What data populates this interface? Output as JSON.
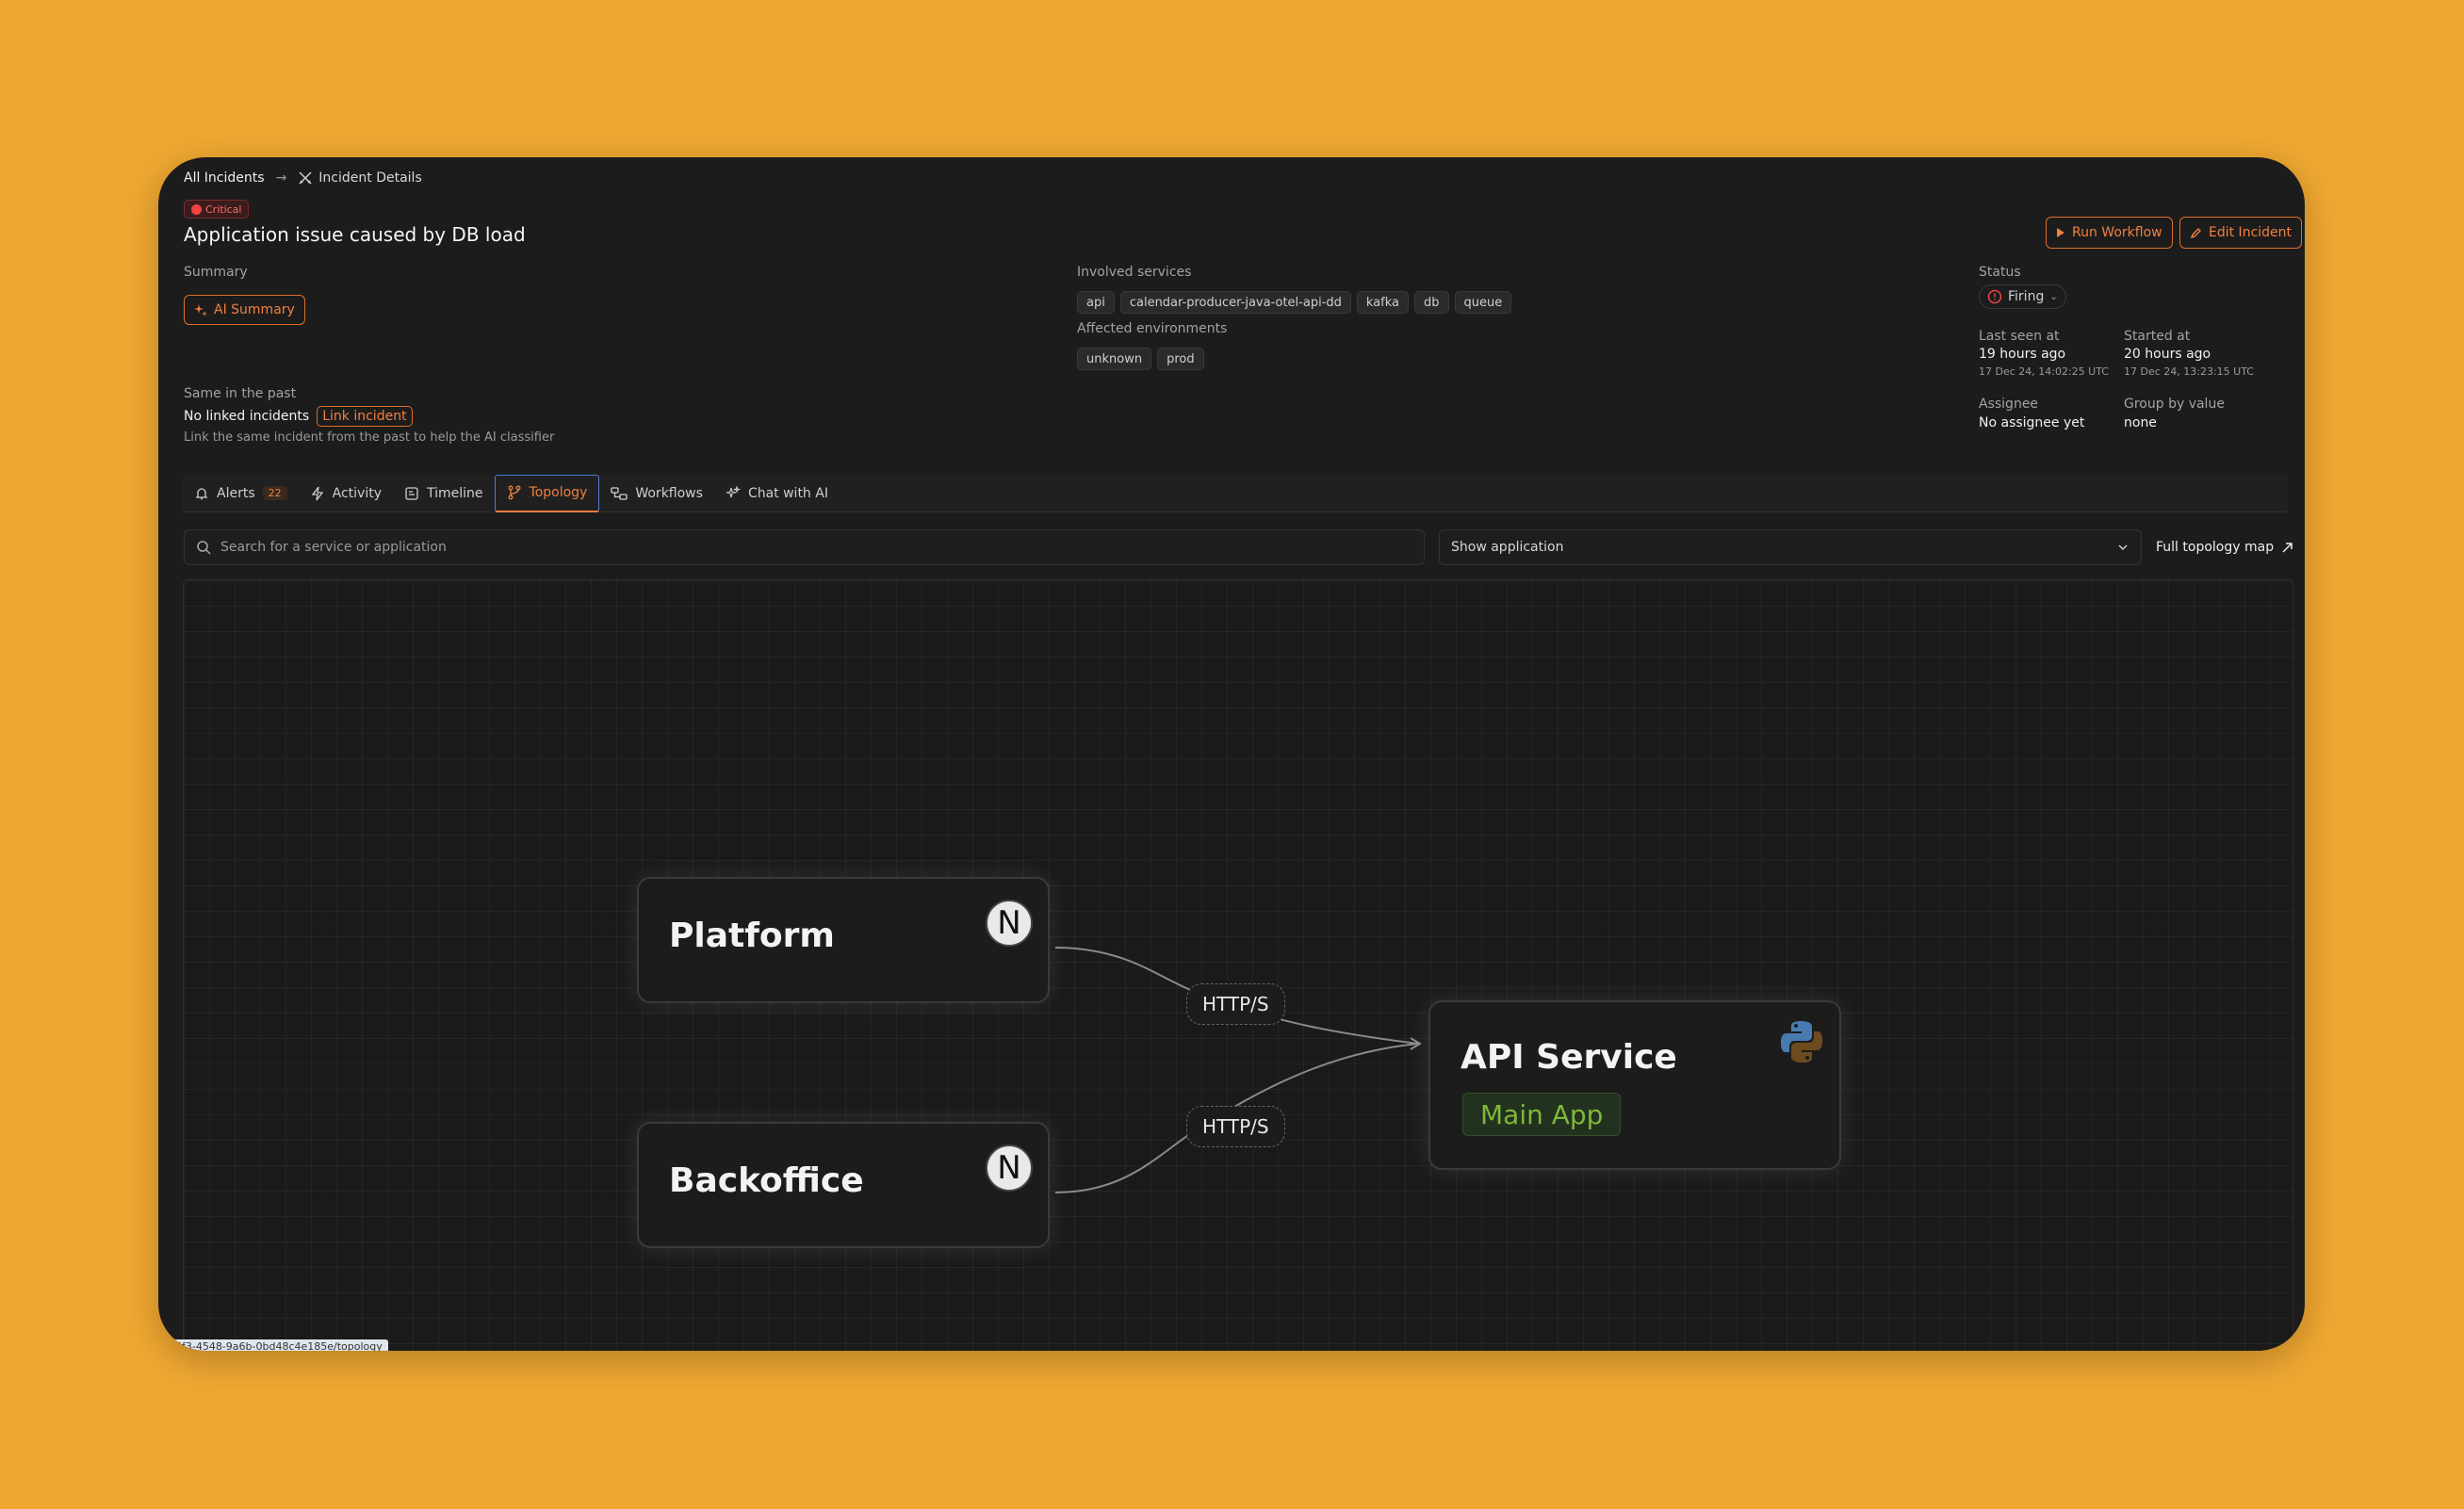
{
  "breadcrumb": {
    "root": "All Incidents",
    "current": "Incident Details"
  },
  "incident": {
    "severity": "Critical",
    "title": "Application issue caused by DB load"
  },
  "actions": {
    "run_workflow": "Run Workflow",
    "edit_incident": "Edit Incident"
  },
  "summary": {
    "label": "Summary",
    "ai_button": "AI Summary"
  },
  "past": {
    "label": "Same in the past",
    "no_linked": "No linked incidents",
    "link_button": "Link incident",
    "hint": "Link the same incident from the past to help the AI classifier"
  },
  "services": {
    "label": "Involved services",
    "items": [
      "api",
      "calendar-producer-java-otel-api-dd",
      "kafka",
      "db",
      "queue"
    ]
  },
  "environments": {
    "label": "Affected environments",
    "items": [
      "unknown",
      "prod"
    ]
  },
  "status": {
    "label": "Status",
    "value": "Firing"
  },
  "last_seen": {
    "label": "Last seen at",
    "value": "19 hours ago",
    "exact": "17 Dec 24, 14:02:25 UTC"
  },
  "started": {
    "label": "Started at",
    "value": "20 hours ago",
    "exact": "17 Dec 24, 13:23:15 UTC"
  },
  "assignee": {
    "label": "Assignee",
    "value": "No assignee yet"
  },
  "group_by": {
    "label": "Group by value",
    "value": "none"
  },
  "tabs": [
    {
      "label": "Alerts",
      "count": "22",
      "icon": "bell-icon"
    },
    {
      "label": "Activity",
      "icon": "lightning-icon"
    },
    {
      "label": "Timeline",
      "icon": "timeline-icon"
    },
    {
      "label": "Topology",
      "icon": "topology-icon",
      "active": true
    },
    {
      "label": "Workflows",
      "icon": "workflow-icon"
    },
    {
      "label": "Chat with AI",
      "icon": "sparkles-icon"
    }
  ],
  "topology": {
    "search_placeholder": "Search for a service or application",
    "select_value": "Show application",
    "full_map": "Full topology map",
    "nodes": {
      "platform": {
        "title": "Platform",
        "logo": "N"
      },
      "backoffice": {
        "title": "Backoffice",
        "logo": "N"
      },
      "api": {
        "title": "API Service",
        "app": "Main App"
      }
    },
    "edges": [
      "HTTP/S",
      "HTTP/S"
    ]
  },
  "status_url": "5f3-4548-9a6b-0bd48c4e185e/topology",
  "colors": {
    "accent": "#f08040",
    "critical": "#ef4444",
    "background": "#f0a832",
    "app_green": "#7fb83a"
  }
}
